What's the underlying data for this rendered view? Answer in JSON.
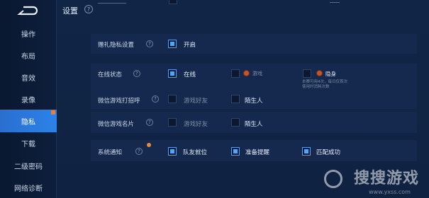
{
  "header": {
    "title": "设置",
    "help": "?"
  },
  "sidebar": {
    "items": [
      {
        "label": "操作"
      },
      {
        "label": "布局"
      },
      {
        "label": "音效"
      },
      {
        "label": "录像"
      },
      {
        "label": "隐私"
      },
      {
        "label": "下载"
      },
      {
        "label": "二级密码"
      },
      {
        "label": "网络诊断"
      }
    ],
    "active_index": 4
  },
  "rows": {
    "gift_privacy": {
      "label": "赠礼隐私设置",
      "option": "开启"
    },
    "online_status": {
      "label": "在线状态",
      "opt1": "在线",
      "opt2": "游戏",
      "opt3": "隐身",
      "note": "本赛可用4次，每日仅首次使用时消耗次数"
    },
    "wechat_greet": {
      "label": "微信游戏打招呼",
      "opt1": "游戏好友",
      "opt2": "陌生人"
    },
    "wechat_card": {
      "label": "微信游戏名片",
      "opt1": "游戏好友",
      "opt2": "陌生人"
    },
    "system_notice": {
      "label": "系统通知",
      "opt1": "队友就位",
      "opt2": "准备提醒",
      "opt3": "匹配成功"
    }
  },
  "watermark": {
    "text": "搜搜游戏",
    "sub": "www.yxss.com"
  },
  "colors": {
    "accent": "#2c82e8",
    "check": "#4aa8ff",
    "badge": "#e9893c"
  }
}
